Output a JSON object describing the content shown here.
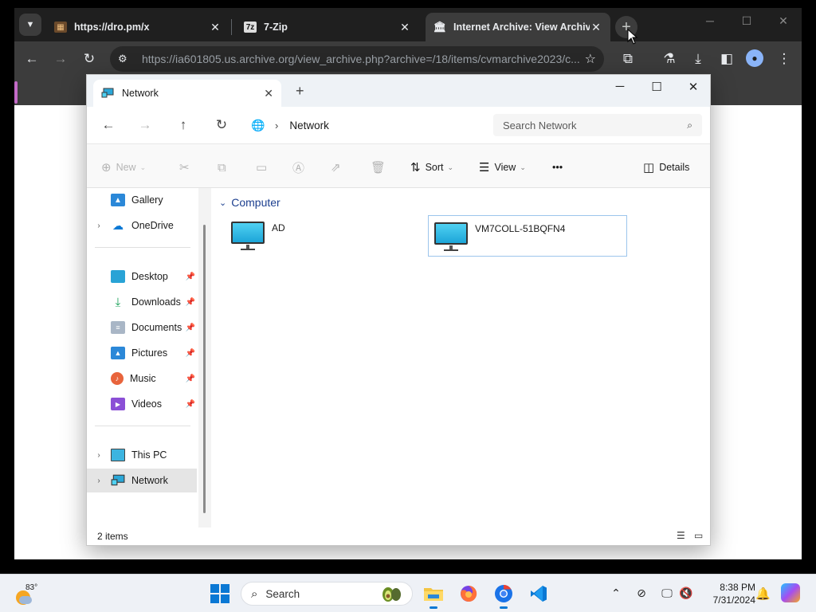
{
  "browser": {
    "tabs": [
      {
        "title": "https://dro.pm/x",
        "icon": "film-icon"
      },
      {
        "title": "7-Zip",
        "icon": "7zip-icon"
      },
      {
        "title": "Internet Archive: View Archive",
        "icon": "archive-icon",
        "active": true
      }
    ],
    "url": "https://ia601805.us.archive.org/view_archive.php?archive=/18/items/cvmarchive2023/c..."
  },
  "explorer": {
    "tab_title": "Network",
    "breadcrumb": "Network",
    "search_placeholder": "Search Network",
    "commands": {
      "new": "New",
      "sort": "Sort",
      "view": "View",
      "more": "•••",
      "details": "Details"
    },
    "sidebar": {
      "top": [
        {
          "label": "Gallery",
          "icon": "gallery-icon"
        },
        {
          "label": "OneDrive",
          "icon": "onedrive-icon"
        }
      ],
      "pinned": [
        {
          "label": "Desktop",
          "icon": "desktop-icon"
        },
        {
          "label": "Downloads",
          "icon": "downloads-icon"
        },
        {
          "label": "Documents",
          "icon": "documents-icon"
        },
        {
          "label": "Pictures",
          "icon": "pictures-icon"
        },
        {
          "label": "Music",
          "icon": "music-icon"
        },
        {
          "label": "Videos",
          "icon": "videos-icon"
        }
      ],
      "bottom": [
        {
          "label": "This PC",
          "icon": "this-pc-icon"
        },
        {
          "label": "Network",
          "icon": "network-icon",
          "selected": true
        }
      ]
    },
    "group": {
      "title": "Computer",
      "items": [
        "AD",
        "VM7COLL-51BQFN4"
      ]
    },
    "status": "2 items"
  },
  "taskbar": {
    "weather_temp": "83°",
    "search_label": "Search",
    "time": "8:38 PM",
    "date": "7/31/2024"
  },
  "colors": {
    "accent": "#0a78d4",
    "group_header": "#1c3f8f",
    "selection_border": "#9cc5ec"
  }
}
